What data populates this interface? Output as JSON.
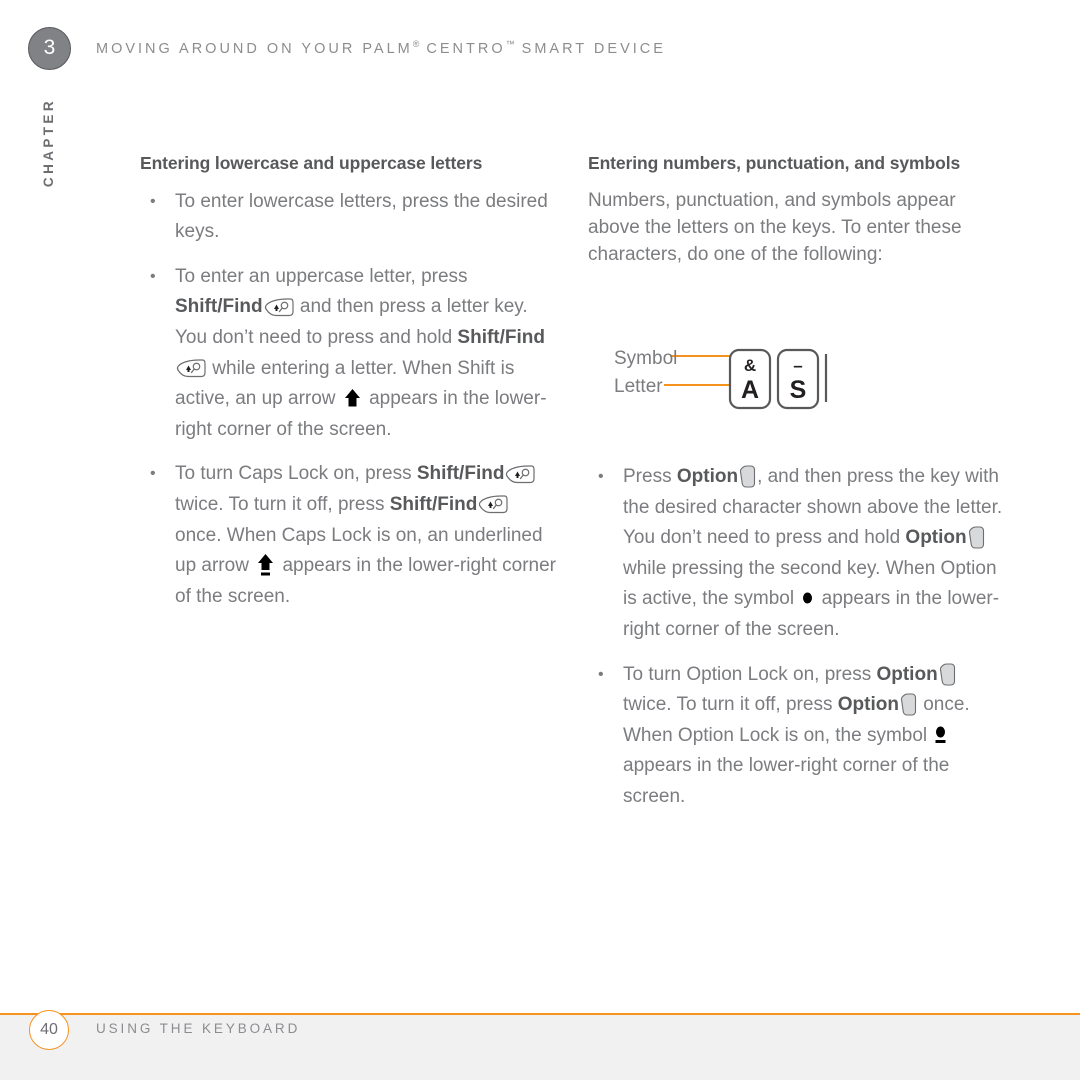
{
  "header": {
    "chapter_number": "3",
    "title_pre": "MOVING AROUND ON YOUR PALM",
    "title_reg": "®",
    "title_mid": " CENTRO",
    "title_tm": "™",
    "title_post": " SMART DEVICE",
    "chapter_word": "CHAPTER"
  },
  "left_column": {
    "section_title": "Entering lowercase and uppercase letters",
    "bullets": [
      {
        "id": "lowercase",
        "parts": [
          {
            "type": "text",
            "value": "To enter lowercase letters, press the desired keys."
          }
        ]
      },
      {
        "id": "uppercase",
        "parts": [
          {
            "type": "text",
            "value": "To enter an uppercase letter, press "
          },
          {
            "type": "bold",
            "value": "Shift/Find"
          },
          {
            "type": "icon",
            "value": "shift-find-key-icon"
          },
          {
            "type": "text",
            "value": " and then press a letter key. You don’t need to press and hold "
          },
          {
            "type": "bold",
            "value": "Shift/Find"
          },
          {
            "type": "icon",
            "value": "shift-find-key-icon"
          },
          {
            "type": "text",
            "value": " while entering a letter. When Shift is active, an up arrow "
          },
          {
            "type": "icon",
            "value": "up-arrow-icon"
          },
          {
            "type": "text",
            "value": " appears in the lower-right corner of the screen."
          }
        ]
      },
      {
        "id": "caps-lock",
        "parts": [
          {
            "type": "text",
            "value": "To turn Caps Lock on, press "
          },
          {
            "type": "bold",
            "value": "Shift/Find"
          },
          {
            "type": "icon",
            "value": "shift-find-key-icon"
          },
          {
            "type": "text",
            "value": " twice. To turn it off, press "
          },
          {
            "type": "bold",
            "value": "Shift/Find"
          },
          {
            "type": "icon",
            "value": "shift-find-key-icon"
          },
          {
            "type": "text",
            "value": " once. When Caps Lock is on, an underlined up arrow "
          },
          {
            "type": "icon",
            "value": "up-arrow-underlined-icon"
          },
          {
            "type": "text",
            "value": " appears in the lower-right corner of the screen."
          }
        ]
      }
    ]
  },
  "right_column": {
    "section_title": "Entering numbers, punctuation, and symbols",
    "intro_paragraph": "Numbers, punctuation, and symbols appear above the letters on the keys. To enter these characters, do one of the following:",
    "diagram": {
      "label_symbol": "Symbol",
      "label_letter": "Letter",
      "keys": [
        {
          "symbol": "&",
          "letter": "A"
        },
        {
          "symbol": "–",
          "letter": "S"
        }
      ],
      "callout_color": "#f6921e"
    },
    "bullets": [
      {
        "id": "press-option",
        "parts": [
          {
            "type": "text",
            "value": "Press "
          },
          {
            "type": "bold",
            "value": "Option"
          },
          {
            "type": "icon",
            "value": "option-key-icon"
          },
          {
            "type": "text",
            "value": ", and then press the key with the desired character shown above the letter. You don’t need to press and hold "
          },
          {
            "type": "bold",
            "value": "Option"
          },
          {
            "type": "icon",
            "value": "option-key-icon"
          },
          {
            "type": "text",
            "value": " while pressing the second key. When Option is active, the symbol "
          },
          {
            "type": "icon",
            "value": "option-dot-icon"
          },
          {
            "type": "text",
            "value": " appears in the lower-right corner of the screen."
          }
        ]
      },
      {
        "id": "option-lock",
        "parts": [
          {
            "type": "text",
            "value": "To turn Option Lock on, press "
          },
          {
            "type": "bold",
            "value": "Option"
          },
          {
            "type": "icon",
            "value": "option-key-icon"
          },
          {
            "type": "text",
            "value": " twice. To turn it off, press "
          },
          {
            "type": "bold",
            "value": "Option"
          },
          {
            "type": "icon",
            "value": "option-key-icon"
          },
          {
            "type": "text",
            "value": " once. When Option Lock is on, the symbol "
          },
          {
            "type": "icon",
            "value": "option-dot-underlined-icon"
          },
          {
            "type": "text",
            "value": " appears in the lower-right corner of the screen."
          }
        ]
      }
    ]
  },
  "footer": {
    "page_number": "40",
    "title": "USING THE KEYBOARD",
    "rule_color": "#f6921e"
  },
  "colors": {
    "accent_orange": "#f6921e",
    "body_gray": "#7b7c7f",
    "heading_gray": "#58595b",
    "header_gray": "#8c8d90",
    "badge_gray": "#808285",
    "footer_band": "#f1f1f1"
  }
}
